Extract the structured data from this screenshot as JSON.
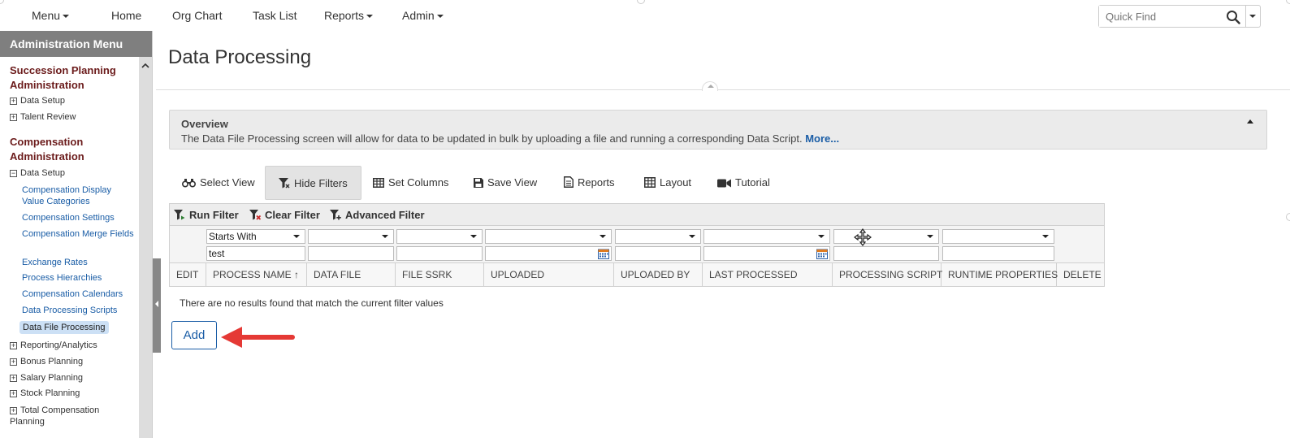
{
  "topnav": {
    "menu": "Menu",
    "home": "Home",
    "org_chart": "Org Chart",
    "task_list": "Task List",
    "reports": "Reports",
    "admin": "Admin",
    "quickfind_placeholder": "Quick Find"
  },
  "sidebar": {
    "header": "Administration Menu",
    "succession_title": "Succession Planning Administration",
    "succession_items": [
      "Data Setup",
      "Talent Review"
    ],
    "compensation_title": "Compensation Administration",
    "comp_data_setup": "Data Setup",
    "comp_links": [
      "Compensation Display Value Categories",
      "Compensation Settings",
      "Compensation Merge Fields",
      "Exchange Rates",
      "Process Hierarchies",
      "Compensation Calendars",
      "Data Processing Scripts"
    ],
    "active_item": "Data File Processing",
    "other_items": [
      "Reporting/Analytics",
      "Bonus Planning",
      "Salary Planning",
      "Stock Planning",
      "Total Compensation Planning"
    ]
  },
  "main": {
    "title": "Data Processing",
    "overview_title": "Overview",
    "overview_text": "The Data File Processing screen will allow for data to be updated in bulk by uploading a file and running a corresponding Data Script.",
    "overview_more": "More...",
    "toolbar": {
      "select_view": "Select View",
      "hide_filters": "Hide Filters",
      "set_columns": "Set Columns",
      "save_view": "Save View",
      "reports": "Reports",
      "layout": "Layout",
      "tutorial": "Tutorial"
    },
    "filterbar": {
      "run_filter": "Run Filter",
      "clear_filter": "Clear Filter",
      "advanced_filter": "Advanced Filter"
    },
    "filter": {
      "process_name_operator": "Starts With",
      "process_name_value": "test"
    },
    "columns": [
      "EDIT",
      "PROCESS NAME",
      "DATA FILE",
      "FILE SSRK",
      "UPLOADED",
      "UPLOADED BY",
      "LAST PROCESSED",
      "PROCESSING SCRIPT",
      "RUNTIME PROPERTIES",
      "DELETE"
    ],
    "sort_indicator": "↑",
    "no_results": "There are no results found that match the current filter values",
    "add_button": "Add"
  },
  "colors": {
    "accent": "#1a5da6",
    "section_title": "#6b1b1b",
    "sidebar_header": "#7f7f7f",
    "arrow": "#e53935"
  }
}
